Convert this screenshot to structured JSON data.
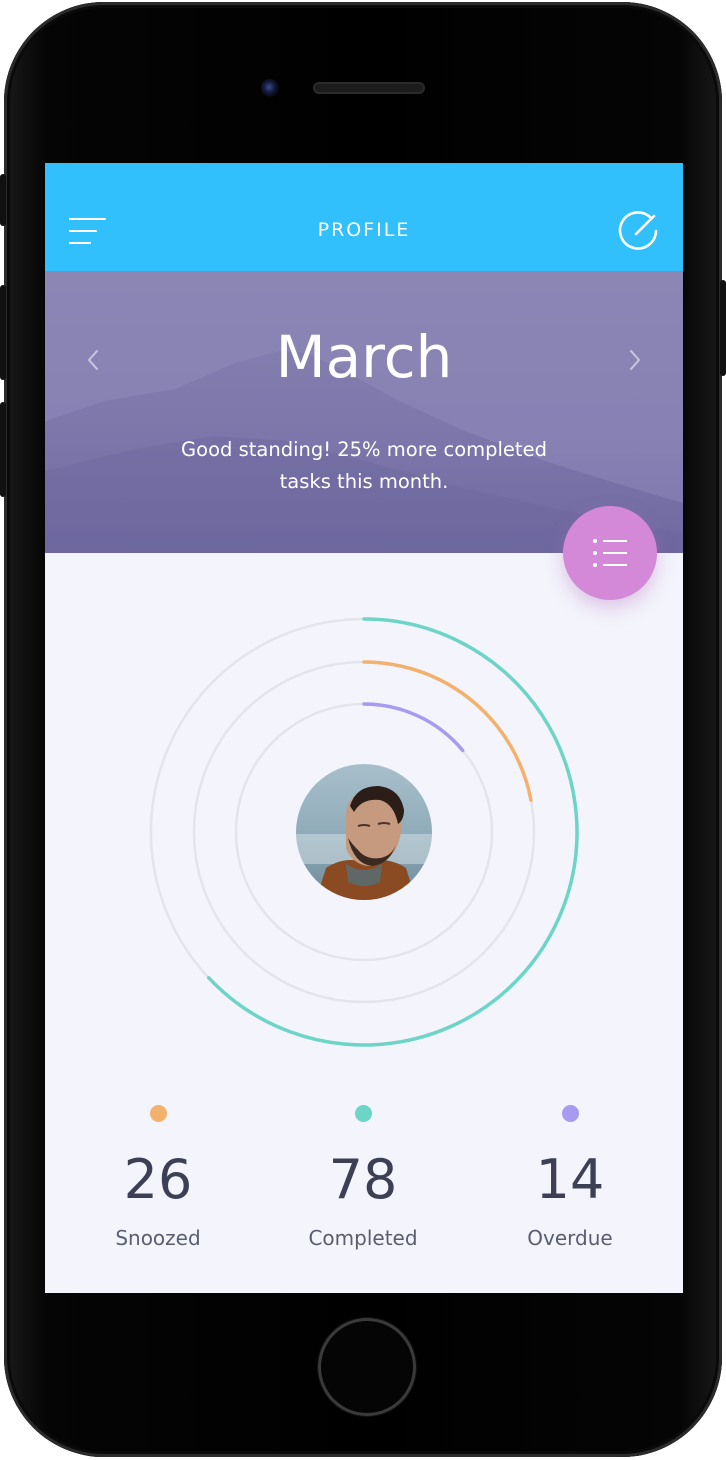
{
  "header": {
    "title": "PROFILE",
    "menu_icon": "hamburger-menu-icon",
    "edit_icon": "edit-pencil-circle-icon",
    "color": "#31c0fb"
  },
  "hero": {
    "month": "March",
    "message": "Good standing! 25% more completed tasks this month.",
    "prev_icon": "chevron-left-icon",
    "next_icon": "chevron-right-icon",
    "fab_icon": "list-icon",
    "fab_color": "#d389d8"
  },
  "progress_rings": [
    {
      "name": "Completed",
      "color": "#6dd4c8",
      "fraction": 0.63
    },
    {
      "name": "Snoozed",
      "color": "#f2b26e",
      "fraction": 0.22
    },
    {
      "name": "Overdue",
      "color": "#a79af0",
      "fraction": 0.14
    }
  ],
  "stats": [
    {
      "label": "Snoozed",
      "value": "26",
      "color": "#f2b26e"
    },
    {
      "label": "Completed",
      "value": "78",
      "color": "#6dd4c8"
    },
    {
      "label": "Overdue",
      "value": "14",
      "color": "#a79af0"
    }
  ]
}
